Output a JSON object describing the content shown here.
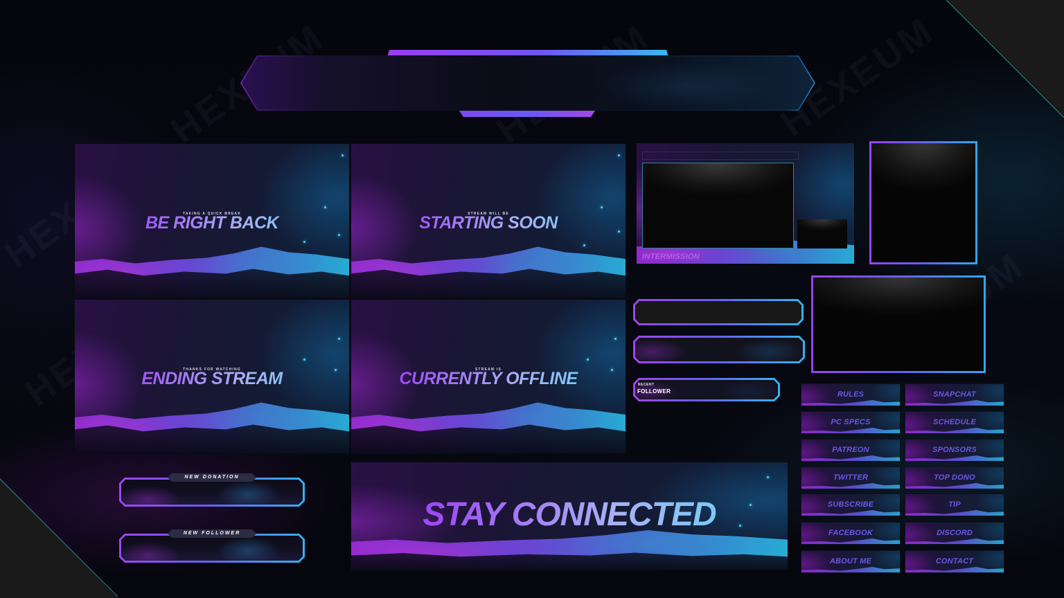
{
  "brand": {
    "watermark": "HEXEUM",
    "accent_purple": "#9d42ee",
    "accent_blue": "#2fa8f3",
    "accent_cyan": "#2cc3ef"
  },
  "top_banner": {
    "label": ""
  },
  "scenes": [
    {
      "id": "brb",
      "subtitle": "TAKING A QUICK BREAK",
      "title": "BE RIGHT BACK"
    },
    {
      "id": "starting",
      "subtitle": "STREAM WILL BE",
      "title": "STARTING SOON"
    },
    {
      "id": "ending",
      "subtitle": "THANKS FOR WATCHING",
      "title": "ENDING STREAM"
    },
    {
      "id": "offline",
      "subtitle": "STREAM IS",
      "title": "CURRENTLY OFFLINE"
    }
  ],
  "intermission": {
    "label": "INTERMISSION"
  },
  "recent_follower": {
    "small": "RECENT",
    "big": "FOLLOWER"
  },
  "alerts": [
    {
      "label": "NEW DONATION"
    },
    {
      "label": "NEW FOLLOWER"
    }
  ],
  "stay_connected": {
    "title": "STAY CONNECTED"
  },
  "panels": {
    "left": [
      "RULES",
      "PC SPECS",
      "PATREON",
      "TWITTER",
      "SUBSCRIBE",
      "FACEBOOK",
      "ABOUT ME"
    ],
    "right": [
      "SNAPCHAT",
      "SCHEDULE",
      "SPONSORS",
      "TOP DONO",
      "TIP",
      "DISCORD",
      "CONTACT"
    ]
  }
}
